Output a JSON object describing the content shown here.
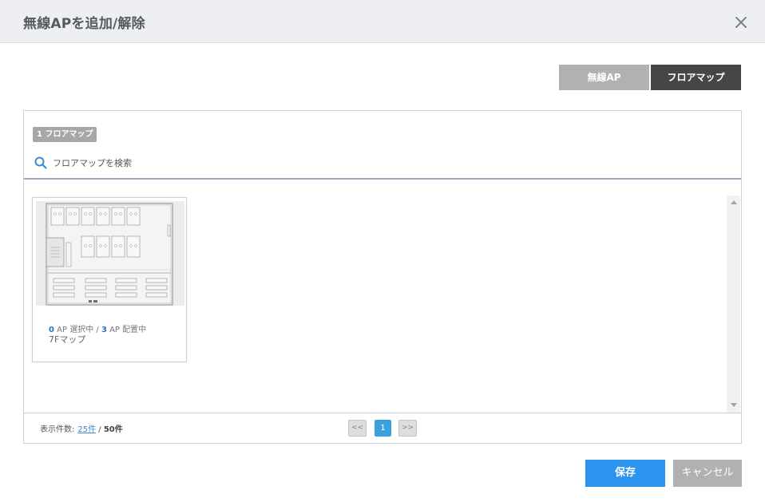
{
  "dialog": {
    "title": "無線APを追加/解除"
  },
  "view_toggle": {
    "ap_label": "無線AP",
    "floormap_label": "フロアマップ"
  },
  "panel": {
    "count_badge": "1 フロアマップ",
    "search_placeholder": "フロアマップを検索",
    "cards": [
      {
        "selected_count": "0",
        "selected_suffix": " AP 選択中 / ",
        "placed_count": "3",
        "placed_suffix": " AP 配置中",
        "name": "7Fマップ"
      }
    ]
  },
  "footer": {
    "per_page_label": "表示件数:",
    "per_page_value": "25件",
    "separator": " / ",
    "total": "50件",
    "prev_label": "<<",
    "current_page": "1",
    "next_label": ">>"
  },
  "buttons": {
    "save_label": "保存",
    "cancel_label": "キャンセル"
  },
  "colors": {
    "accent": "#2c94ee",
    "page_active": "#3aa1de",
    "toggle_active": "#464646",
    "toggle_inactive": "#b1b1b1"
  }
}
